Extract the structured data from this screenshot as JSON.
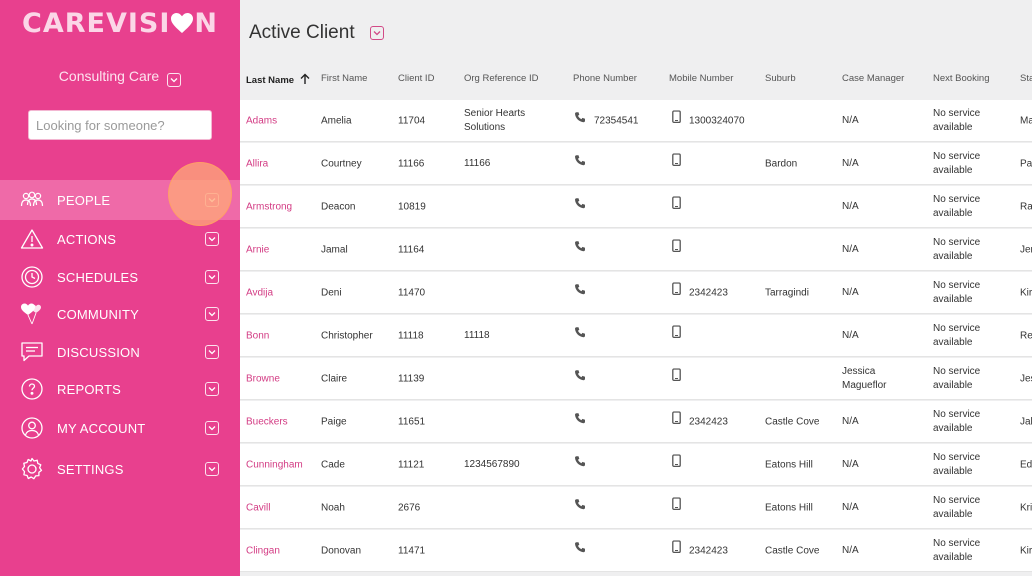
{
  "app": {
    "logo_text_left": "CAREVISI",
    "logo_text_right": "N",
    "org_name": "Consulting Care",
    "search_placeholder": "Looking for someone?"
  },
  "colors": {
    "brand": "#e8408e",
    "active": "#ef6aa8",
    "link": "#d33c84"
  },
  "nav": [
    {
      "label": "PEOPLE",
      "icon": "people-icon",
      "active": true
    },
    {
      "label": "ACTIONS",
      "icon": "warning-icon"
    },
    {
      "label": "SCHEDULES",
      "icon": "clock-icon"
    },
    {
      "label": "COMMUNITY",
      "icon": "heart-balloon-icon"
    },
    {
      "label": "DISCUSSION",
      "icon": "chat-icon"
    },
    {
      "label": "REPORTS",
      "icon": "report-icon"
    },
    {
      "label": "MY ACCOUNT",
      "icon": "user-icon"
    },
    {
      "label": "SETTINGS",
      "icon": "gear-icon"
    }
  ],
  "page": {
    "title": "Active Client"
  },
  "table": {
    "headers": [
      "Last Name",
      "First Name",
      "Client ID",
      "Org Reference ID",
      "Phone Number",
      "Mobile Number",
      "Suburb",
      "Case Manager",
      "Next Booking",
      "Sta"
    ],
    "rows": [
      [
        "Adams",
        "Amelia",
        "11704",
        "Senior Hearts Solutions",
        "72354541",
        "1300324070",
        "",
        "N/A",
        "No service available",
        "Ma"
      ],
      [
        "Allira",
        "Courtney",
        "11166",
        "11166",
        "",
        "",
        "Bardon",
        "N/A",
        "No service available",
        "Pa"
      ],
      [
        "Armstrong",
        "Deacon",
        "10819",
        "",
        "",
        "",
        "",
        "N/A",
        "No service available",
        "Ra"
      ],
      [
        "Arnie",
        "Jamal",
        "11164",
        "",
        "",
        "",
        "",
        "N/A",
        "No service available",
        "Jer"
      ],
      [
        "Avdija",
        "Deni",
        "11470",
        "",
        "",
        "2342423",
        "Tarragindi",
        "N/A",
        "No service available",
        "Kir"
      ],
      [
        "Bonn",
        "Christopher",
        "11118",
        "11118",
        "",
        "",
        "",
        "N/A",
        "No service available",
        "Re"
      ],
      [
        "Browne",
        "Claire",
        "11139",
        "",
        "",
        "",
        "",
        "Jessica Magueflor",
        "No service available",
        "Jes"
      ],
      [
        "Bueckers",
        "Paige",
        "11651",
        "",
        "",
        "2342423",
        "Castle Cove",
        "N/A",
        "No service available",
        "Jal"
      ],
      [
        "Cunningham",
        "Cade",
        "11121",
        "1234567890",
        "",
        "",
        "Eatons Hill",
        "N/A",
        "No service available",
        "Ed"
      ],
      [
        "Cavill",
        "Noah",
        "2676",
        "",
        "",
        "",
        "Eatons Hill",
        "N/A",
        "No service available",
        "Kri"
      ],
      [
        "Clingan",
        "Donovan",
        "11471",
        "",
        "",
        "2342423",
        "Castle Cove",
        "N/A",
        "No service available",
        "Kir"
      ]
    ]
  }
}
